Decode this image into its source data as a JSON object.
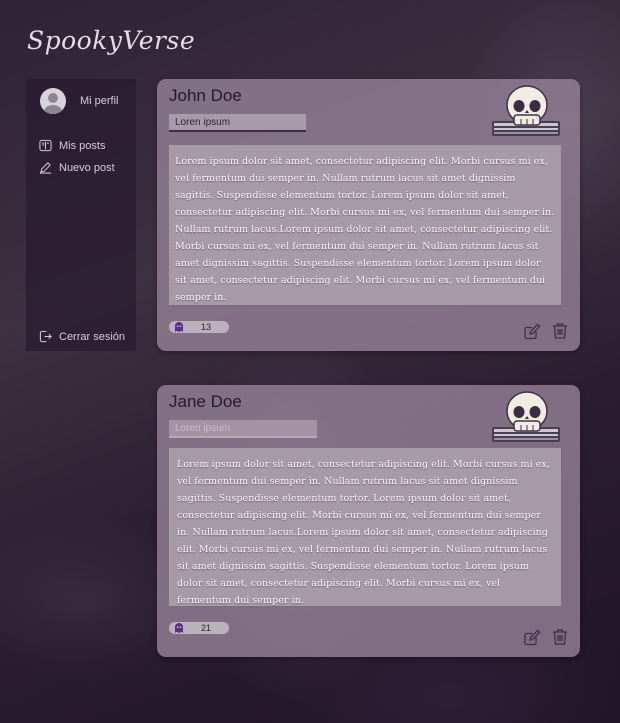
{
  "app": {
    "logo": "SpookyVerse"
  },
  "sidebar": {
    "profile_label": "Mi perfil",
    "items": [
      {
        "label": "Mis posts",
        "icon": "book-icon"
      },
      {
        "label": "Nuevo post",
        "icon": "pencil-icon"
      }
    ],
    "logout_label": "Cerrar sesión"
  },
  "posts": [
    {
      "author": "John Doe",
      "tag": "Loren ipsum",
      "body": "Lorem ipsum dolor sit amet, consectetur adipiscing elit. Morbi cursus mi ex, vel fermentum dui semper in. Nullam rutrum lacus sit amet dignissim sagittis. Suspendisse elementum tortor. Lorem ipsum dolor sit amet, consectetur adipiscing elit. Morbi cursus mi ex, vel fermentum dui semper in. Nullam rutrum lacus.Lorem ipsum dolor sit amet, consectetur adipiscing elit. Morbi cursus mi ex, vel fermentum dui semper in. Nullam rutrum lacus sit amet dignissim sagittis. Suspendisse elementum tortor. Lorem ipsum dolor sit amet, consectetur adipiscing elit. Morbi cursus mi ex, vel fermentum dui semper in.",
      "likes": "13"
    },
    {
      "author": "Jane Doe",
      "tag": "Loren ipsum",
      "body": "Lorem ipsum dolor sit amet, consectetur adipiscing elit. Morbi cursus mi ex, vel fermentum dui semper in. Nullam rutrum lacus sit amet dignissim sagittis. Suspendisse elementum tortor. Lorem ipsum dolor sit amet, consectetur adipiscing elit. Morbi cursus mi ex, vel fermentum dui semper in. Nullam rutrum lacus.Lorem ipsum dolor sit amet, consectetur adipiscing elit. Morbi cursus mi ex, vel fermentum dui semper in. Nullam rutrum lacus sit amet dignissim sagittis. Suspendisse elementum tortor. Lorem ipsum dolor sit amet, consectetur adipiscing elit. Morbi cursus mi ex, vel fermentum dui semper in.",
      "likes": "21"
    }
  ],
  "colors": {
    "accent": "#5b2d8c",
    "card_bg": "#948096",
    "sidebar_bg": "#281c30"
  }
}
